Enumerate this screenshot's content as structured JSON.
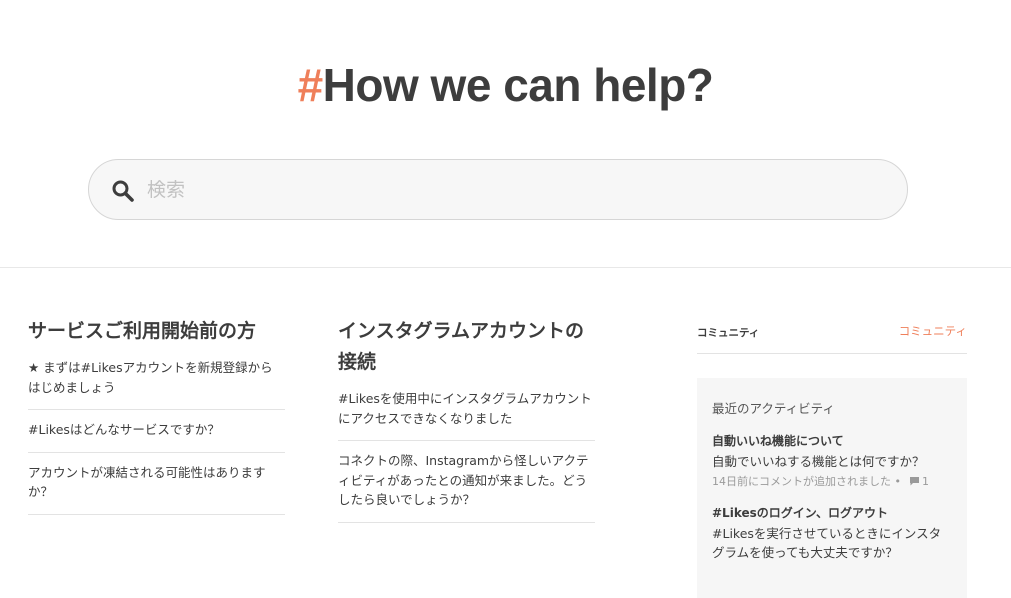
{
  "hero": {
    "hash": "#",
    "title": "How we can help?"
  },
  "search": {
    "placeholder": "検索",
    "icon": "search-icon"
  },
  "sections": [
    {
      "title": "サービスご利用開始前の方",
      "articles": [
        "★ まずは#Likesアカウントを新規登録からはじめましょう",
        "#Likesはどんなサービスですか？",
        "アカウントが凍結される可能性はありますか？"
      ]
    },
    {
      "title": "インスタグラムアカウントの接続",
      "articles": [
        "#Likesを使用中にインスタグラムアカウントにアクセスできなくなりました",
        "コネクトの際、Instagramから怪しいアクティビティがあったとの通知が来ました。どうしたら良いでしょうか？"
      ]
    }
  ],
  "sidebar": {
    "label": "コミュニティ",
    "link": "コミュニティ",
    "activity": {
      "heading": "最近のアクティビティ",
      "items": [
        {
          "title": "自動いいね機能について",
          "body": "自動でいいねする機能とは何ですか？",
          "meta": "14日前にコメントが追加されました •",
          "comments": "1"
        },
        {
          "title": "#Likesのログイン、ログアウト",
          "body": "#Likesを実行させているときにインスタグラムを使っても大丈夫ですか？"
        }
      ]
    }
  },
  "colors": {
    "accent": "#ef7f5a",
    "text": "#3d3d3d",
    "muted": "#9a9a9a"
  }
}
